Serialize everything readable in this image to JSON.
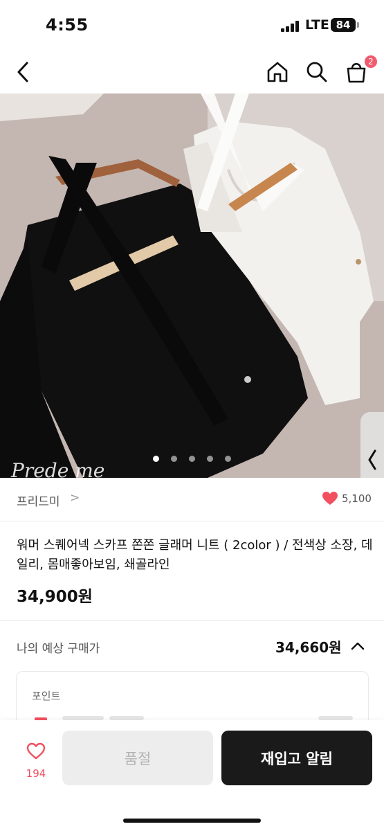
{
  "status_bar": {
    "time": "4:55",
    "network": "LTE",
    "battery": "84"
  },
  "nav": {
    "back_icon": "chevron-left-icon",
    "home_icon": "home-icon",
    "search_icon": "search-icon",
    "cart_icon": "shopping-bag-icon",
    "cart_badge": "2",
    "badge_color": "#f25a6e"
  },
  "gallery": {
    "watermark": "Prede me",
    "page_count": 5,
    "current_page": 1,
    "expand_icon": "expand-icon",
    "side_tab_icon": "chevron-left-icon"
  },
  "brand": {
    "name": "프리드미",
    "arrow": ">",
    "like_count": "5,100",
    "like_icon": "heart-filled-icon"
  },
  "product": {
    "title": "워머 스퀘어넥 스카프 쫀쫀 글래머 니트 ( 2color ) / 전색상 소장, 데일리, 몸매좋아보임, 쇄골라인",
    "price": "34,900원"
  },
  "estimate": {
    "label": "나의 예상 구매가",
    "price": "34,660원",
    "toggle_icon": "chevron-up-icon"
  },
  "points": {
    "title": "포인트"
  },
  "bottom_bar": {
    "wish_icon": "heart-outline-icon",
    "wish_count": "194",
    "soldout_label": "품절",
    "restock_label": "재입고 알림",
    "accent_color": "#f2505f"
  }
}
